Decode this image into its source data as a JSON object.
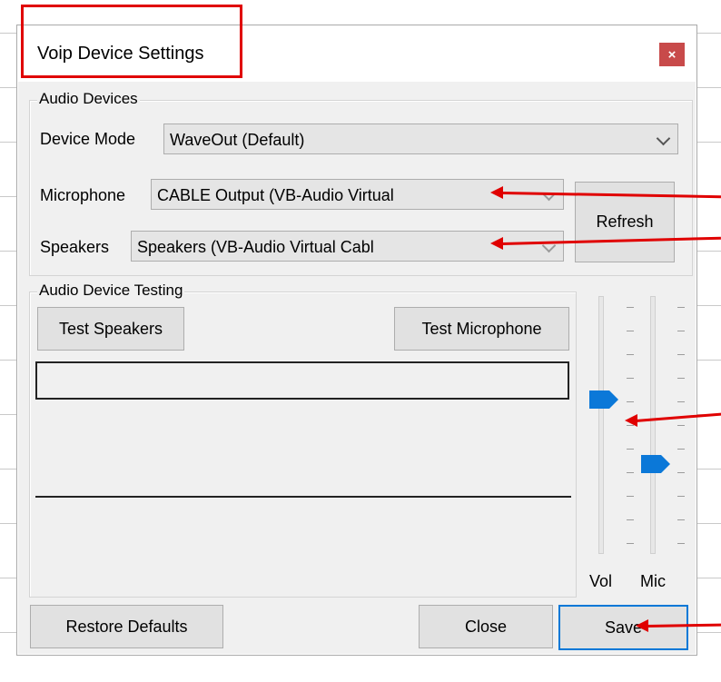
{
  "window": {
    "title": "Voip Device Settings",
    "close_icon": "×"
  },
  "audio_devices": {
    "legend": "Audio Devices",
    "device_mode_label": "Device Mode",
    "device_mode_value": "WaveOut (Default)",
    "microphone_label": "Microphone",
    "microphone_value": "CABLE Output (VB-Audio Virtual",
    "speakers_label": "Speakers",
    "speakers_value": "Speakers (VB-Audio Virtual Cabl",
    "refresh_label": "Refresh"
  },
  "testing": {
    "legend": "Audio Device Testing",
    "test_speakers_label": "Test Speakers",
    "test_microphone_label": "Test Microphone"
  },
  "sliders": {
    "vol_label": "Vol",
    "mic_label": "Mic",
    "vol_level": 0.6,
    "mic_level": 0.35
  },
  "footer": {
    "restore_label": "Restore Defaults",
    "close_label": "Close",
    "save_label": "Save"
  },
  "colors": {
    "annotation": "#e00000",
    "accent": "#0078d7",
    "close_button": "#c84a4a"
  }
}
